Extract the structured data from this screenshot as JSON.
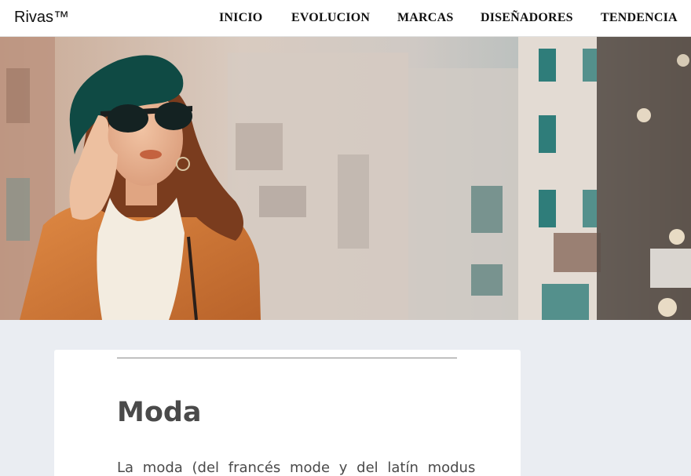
{
  "navbar": {
    "brand": "Rivas™",
    "links": [
      "INICIO",
      "EVOLUCION",
      "MARCAS",
      "DISEÑADORES",
      "TENDENCIA"
    ]
  },
  "hero": {
    "image_subject": "woman in beret and sunglasses on city street",
    "colors": {
      "beret": "#0f4a44",
      "coat": "#d07a35",
      "sweater": "#f3ece0",
      "hair": "#7a3c1e"
    }
  },
  "article": {
    "title": "Moda",
    "intro": "La moda (del francés mode y del latín modus"
  }
}
